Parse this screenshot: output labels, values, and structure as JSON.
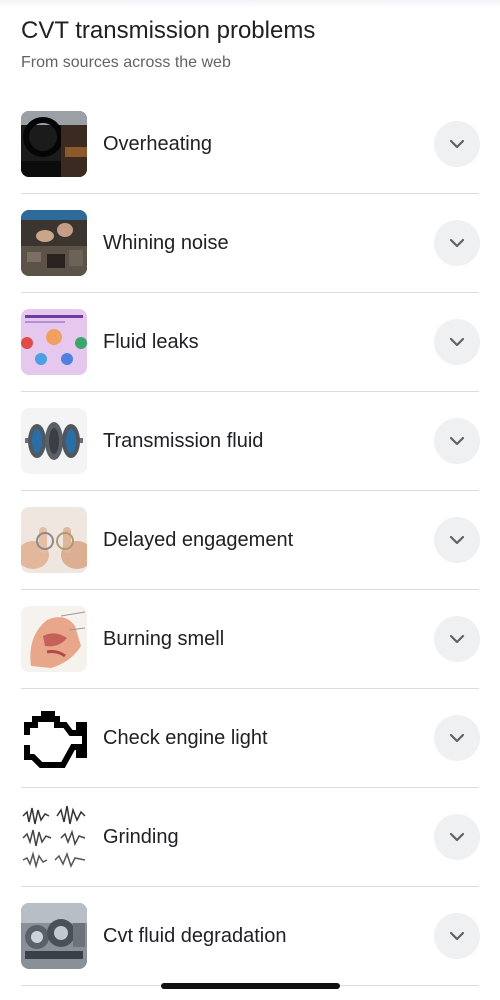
{
  "header": {
    "title": "CVT transmission problems",
    "subtitle": "From sources across the web"
  },
  "items": [
    {
      "label": "Overheating",
      "icon": "car-interior-photo"
    },
    {
      "label": "Whining noise",
      "icon": "engine-repair-photo"
    },
    {
      "label": "Fluid leaks",
      "icon": "infographic-thumbnail"
    },
    {
      "label": "Transmission fluid",
      "icon": "transmission-gears-photo"
    },
    {
      "label": "Delayed engagement",
      "icon": "rings-hands-photo"
    },
    {
      "label": "Burning smell",
      "icon": "nasal-anatomy-illustration"
    },
    {
      "label": "Check engine light",
      "icon": "check-engine-icon"
    },
    {
      "label": "Grinding",
      "icon": "sound-waveform-icon"
    },
    {
      "label": "Cvt fluid degradation",
      "icon": "gearbox-cutaway-photo"
    }
  ],
  "colors": {
    "divider": "#dadce0",
    "expand_button_bg": "#eef0f2",
    "chevron": "#5f6368",
    "text_primary": "#202124",
    "text_secondary": "#5f6368"
  }
}
